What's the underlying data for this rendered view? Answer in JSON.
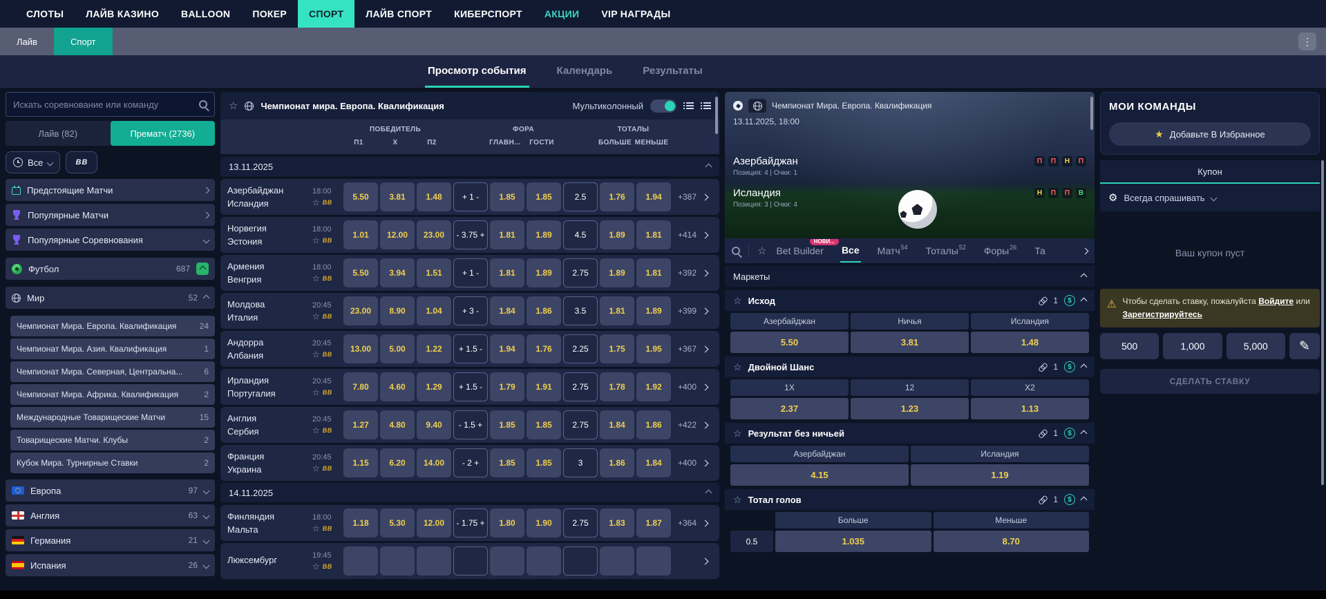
{
  "topnav": {
    "items": [
      {
        "key": "slots",
        "label": "СЛОТЫ"
      },
      {
        "key": "live-casino",
        "label": "ЛАЙВ КАЗИНО"
      },
      {
        "key": "balloon",
        "label": "BALLOON"
      },
      {
        "key": "poker",
        "label": "ПОКЕР"
      },
      {
        "key": "sport",
        "label": "СПОРТ",
        "active": true
      },
      {
        "key": "live-sport",
        "label": "ЛАЙВ СПОРТ"
      },
      {
        "key": "esports",
        "label": "КИБЕРСПОРТ"
      },
      {
        "key": "promotions",
        "label": "АКЦИИ",
        "accent": true
      },
      {
        "key": "vip-rewards",
        "label": "VIP НАГРАДЫ"
      }
    ]
  },
  "subnav": {
    "live": "Лайв",
    "sport": "Спорт"
  },
  "view_tabs": {
    "event": "Просмотр события",
    "calendar": "Календарь",
    "results": "Результаты"
  },
  "sidebar": {
    "search_placeholder": "Искать соревнование или команду",
    "live_tab": "Лайв (82)",
    "prematch_tab": "Прематч (2736)",
    "time_filter": "Все",
    "bb_filter": "BB",
    "quick_links": [
      {
        "key": "upcoming-matches",
        "label": "Предстоящие Матчи",
        "icon": "calendar-icon",
        "chevron": "right"
      },
      {
        "key": "popular-matches",
        "label": "Популярные Матчи",
        "icon": "trophy-icon",
        "chevron": "right"
      },
      {
        "key": "popular-competitions",
        "label": "Популярные Соревнования",
        "icon": "trophy-icon",
        "chevron": "down"
      }
    ],
    "sport": {
      "label": "Футбол",
      "count": "687"
    },
    "region": {
      "label": "Мир",
      "count": "52"
    },
    "leagues": [
      {
        "label": "Чемпионат Мира. Европа. Квалификация",
        "count": "24"
      },
      {
        "label": "Чемпионат Мира. Азия. Квалификация",
        "count": "1"
      },
      {
        "label": "Чемпионат Мира.  Северная, Центральна...",
        "count": "6"
      },
      {
        "label": "Чемпионат Мира. Африка. Квалификация",
        "count": "2"
      },
      {
        "label": "Международные Товарищеские Матчи",
        "count": "15"
      },
      {
        "label": "Товарищеские Матчи. Клубы",
        "count": "2"
      },
      {
        "label": "Кубок Мира. Турнирные Ставки",
        "count": "2"
      }
    ],
    "countries": [
      {
        "label": "Европа",
        "count": "97",
        "flag": "eu"
      },
      {
        "label": "Англия",
        "count": "63",
        "flag": "en"
      },
      {
        "label": "Германия",
        "count": "21",
        "flag": "de"
      },
      {
        "label": "Испания",
        "count": "26",
        "flag": "es"
      }
    ]
  },
  "center": {
    "title": "Чемпионат мира. Европа. Квалификация",
    "multicolumn_label": "Мультиколонный",
    "bb_badge": "BB",
    "columns": {
      "winner": "ПОБЕДИТЕЛЬ",
      "p1": "П1",
      "x": "X",
      "p2": "П2",
      "handicap": "ФОРА",
      "home": "ГЛАВН...",
      "away": "ГОСТИ",
      "totals": "ТОТАЛЫ",
      "over": "БОЛЬШЕ",
      "under": "МЕНЬШЕ"
    },
    "groups": [
      {
        "date": "13.11.2025",
        "matches": [
          {
            "home": "Азербайджан",
            "away": "Исландия",
            "time": "18:00",
            "p1": "5.50",
            "x": "3.81",
            "p2": "1.48",
            "hline": "+ 1 -",
            "h1": "1.85",
            "h2": "1.85",
            "tline": "2.5",
            "over": "1.76",
            "under": "1.94",
            "more": "+387"
          },
          {
            "home": "Норвегия",
            "away": "Эстония",
            "time": "18:00",
            "p1": "1.01",
            "x": "12.00",
            "p2": "23.00",
            "hline": "- 3.75 +",
            "h1": "1.81",
            "h2": "1.89",
            "tline": "4.5",
            "over": "1.89",
            "under": "1.81",
            "more": "+414"
          },
          {
            "home": "Армения",
            "away": "Венгрия",
            "time": "18:00",
            "p1": "5.50",
            "x": "3.94",
            "p2": "1.51",
            "hline": "+ 1 -",
            "h1": "1.81",
            "h2": "1.89",
            "tline": "2.75",
            "over": "1.89",
            "under": "1.81",
            "more": "+392"
          },
          {
            "home": "Молдова",
            "away": "Италия",
            "time": "20:45",
            "p1": "23.00",
            "x": "8.90",
            "p2": "1.04",
            "hline": "+ 3 -",
            "h1": "1.84",
            "h2": "1.86",
            "tline": "3.5",
            "over": "1.81",
            "under": "1.89",
            "more": "+399"
          },
          {
            "home": "Андорра",
            "away": "Албания",
            "time": "20:45",
            "p1": "13.00",
            "x": "5.00",
            "p2": "1.22",
            "hline": "+ 1.5 -",
            "h1": "1.94",
            "h2": "1.76",
            "tline": "2.25",
            "over": "1.75",
            "under": "1.95",
            "more": "+367"
          },
          {
            "home": "Ирландия",
            "away": "Португалия",
            "time": "20:45",
            "p1": "7.80",
            "x": "4.60",
            "p2": "1.29",
            "hline": "+ 1.5 -",
            "h1": "1.79",
            "h2": "1.91",
            "tline": "2.75",
            "over": "1.78",
            "under": "1.92",
            "more": "+400"
          },
          {
            "home": "Англия",
            "away": "Сербия",
            "time": "20:45",
            "p1": "1.27",
            "x": "4.80",
            "p2": "9.40",
            "hline": "- 1.5 +",
            "h1": "1.85",
            "h2": "1.85",
            "tline": "2.75",
            "over": "1.84",
            "under": "1.86",
            "more": "+422"
          },
          {
            "home": "Франция",
            "away": "Украина",
            "time": "20:45",
            "p1": "1.15",
            "x": "6.20",
            "p2": "14.00",
            "hline": "- 2 +",
            "h1": "1.85",
            "h2": "1.85",
            "tline": "3",
            "over": "1.86",
            "under": "1.84",
            "more": "+400"
          }
        ]
      },
      {
        "date": "14.11.2025",
        "matches": [
          {
            "home": "Финляндия",
            "away": "Мальта",
            "time": "18:00",
            "p1": "1.18",
            "x": "5.30",
            "p2": "12.00",
            "hline": "- 1.75 +",
            "h1": "1.80",
            "h2": "1.90",
            "tline": "2.75",
            "over": "1.83",
            "under": "1.87",
            "more": "+364"
          },
          {
            "home": "Люксембург",
            "away": "",
            "time": "19:45",
            "p1": "",
            "x": "",
            "p2": "",
            "hline": "",
            "h1": "",
            "h2": "",
            "tline": "",
            "over": "",
            "under": "",
            "more": ""
          }
        ]
      }
    ]
  },
  "detail": {
    "league": "Чемпионат Мира. Европа. Квалификация",
    "datetime": "13.11.2025, 18:00",
    "home": {
      "name": "Азербайджан",
      "meta": "Позиция: 4 | Очки: 1",
      "form": [
        "П",
        "П",
        "Н",
        "П"
      ]
    },
    "away": {
      "name": "Исландия",
      "meta": "Позиция: 3 | Очки: 4",
      "form": [
        "Н",
        "П",
        "П",
        "В"
      ]
    },
    "tabs": [
      {
        "key": "bet-builder",
        "label": "Bet Builder",
        "badge": "НОВИ..."
      },
      {
        "key": "all",
        "label": "Все",
        "active": true
      },
      {
        "key": "match",
        "label": "Матч",
        "count": "54"
      },
      {
        "key": "totals",
        "label": "Тоталы",
        "count": "52"
      },
      {
        "key": "handicaps",
        "label": "Форы",
        "count": "26"
      },
      {
        "key": "more",
        "label": "Та"
      }
    ],
    "markets_label": "Маркеты",
    "markets": [
      {
        "name": "Исход",
        "count": "1",
        "options": [
          {
            "label": "Азербайджан",
            "odd": "5.50"
          },
          {
            "label": "Ничья",
            "odd": "3.81"
          },
          {
            "label": "Исландия",
            "odd": "1.48"
          }
        ]
      },
      {
        "name": "Двойной Шанс",
        "count": "1",
        "options": [
          {
            "label": "1X",
            "odd": "2.37"
          },
          {
            "label": "12",
            "odd": "1.23"
          },
          {
            "label": "X2",
            "odd": "1.13"
          }
        ]
      },
      {
        "name": "Результат без ничьей",
        "count": "1",
        "options": [
          {
            "label": "Азербайджан",
            "odd": "4.15"
          },
          {
            "label": "Исландия",
            "odd": "1.19"
          }
        ]
      },
      {
        "name": "Тотал голов",
        "count": "1",
        "line": "0.5",
        "options": [
          {
            "label": "Больше",
            "odd": "1.035"
          },
          {
            "label": "Меньше",
            "odd": "8.70"
          }
        ]
      }
    ]
  },
  "betslip": {
    "my_teams_title": "МОИ КОМАНДЫ",
    "add_favorites": "Добавьте В Избранное",
    "coupon_tab": "Купон",
    "ask_mode": "Всегда спрашивать",
    "empty": "Ваш купон пуст",
    "login_note": {
      "prefix": "Чтобы сделать ставку, пожалуйста",
      "login": "Войдите",
      "or": "или",
      "register": "Зарегистрируйтесь"
    },
    "amounts": [
      "500",
      "1,000",
      "5,000"
    ],
    "place_bet": "СДЕЛАТЬ СТАВКУ"
  },
  "colors": {
    "topnav_bg": "#111a31",
    "active_nav": "#35e2c1",
    "accent_teal": "#2bd4b4",
    "subnav_teal": "#12a290",
    "odds_yellow": "#f0cf4e",
    "badge_pink": "#d6336c",
    "warn_yellow": "#f2c94c",
    "form_win": "#4fd66f",
    "form_loss": "#ff5b63",
    "form_draw": "#ffd34d"
  }
}
